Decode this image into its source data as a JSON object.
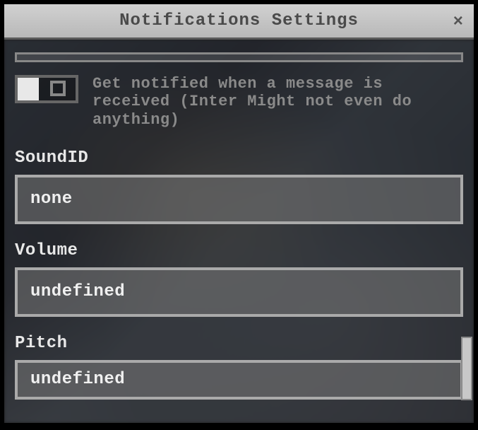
{
  "window": {
    "title": "Notifications Settings",
    "close_glyph": "×"
  },
  "toggle": {
    "description": "Get notified when a message is received (Inter Might not even do anything)"
  },
  "fields": {
    "sound_id": {
      "label": "SoundID",
      "value": "none"
    },
    "volume": {
      "label": "Volume",
      "value": "undefined"
    },
    "pitch": {
      "label": "Pitch",
      "value": "undefined"
    }
  }
}
